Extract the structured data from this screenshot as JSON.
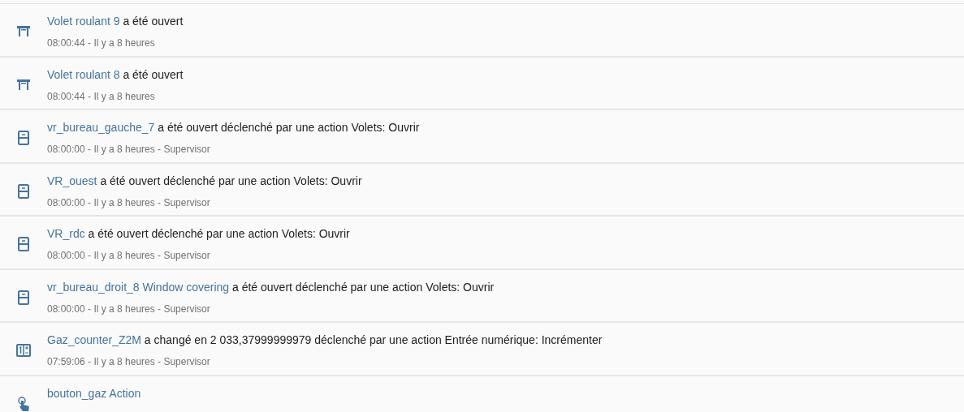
{
  "entries": [
    {
      "kind": "awning",
      "entity": "Volet roulant 9",
      "message": "a été ouvert",
      "meta": "08:00:44 - Il y a 8 heures"
    },
    {
      "kind": "awning",
      "entity": "Volet roulant 8",
      "message": "a été ouvert",
      "meta": "08:00:44 - Il y a 8 heures"
    },
    {
      "kind": "shutter",
      "entity": "vr_bureau_gauche_7",
      "message": "a été ouvert déclenché par une action Volets: Ouvrir",
      "meta": "08:00:00 - Il y a 8 heures - Supervisor"
    },
    {
      "kind": "shutter",
      "entity": "VR_ouest",
      "message": "a été ouvert déclenché par une action Volets: Ouvrir",
      "meta": "08:00:00 - Il y a 8 heures - Supervisor"
    },
    {
      "kind": "shutter",
      "entity": "VR_rdc",
      "message": "a été ouvert déclenché par une action Volets: Ouvrir",
      "meta": "08:00:00 - Il y a 8 heures - Supervisor"
    },
    {
      "kind": "shutter",
      "entity": "vr_bureau_droit_8 Window covering",
      "message": "a été ouvert déclenché par une action Volets: Ouvrir",
      "meta": "08:00:00 - Il y a 8 heures - Supervisor"
    },
    {
      "kind": "counter",
      "entity": "Gaz_counter_Z2M",
      "message": "a changé en 2 033,37999999979 déclenché par une action Entrée numérique: Incrémenter",
      "meta": "07:59:06 - Il y a 8 heures - Supervisor"
    },
    {
      "kind": "touch",
      "entity": "bouton_gaz Action"
    }
  ]
}
